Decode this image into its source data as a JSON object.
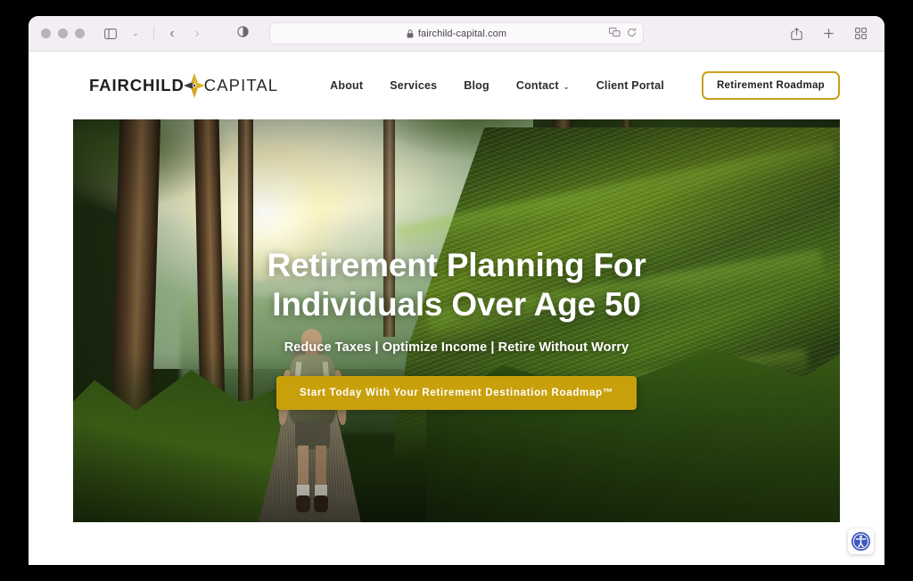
{
  "browser": {
    "window_controls": [
      "close",
      "minimize",
      "maximize"
    ],
    "sidebar_icon": "sidebar-icon",
    "sidebar_caret": "⌄",
    "back_glyph": "‹",
    "forward_glyph": "›",
    "privacy_icon": "privacy-shield-icon",
    "url": "fairchild-capital.com",
    "url_lock": "lock-icon",
    "extension_icon": "extensions-icon",
    "reload_glyph": "↻",
    "share_icon": "share-icon",
    "new_tab_glyph": "+",
    "tab_overview_icon": "tab-overview-icon"
  },
  "site": {
    "logo": {
      "word1": "FAIRCHILD",
      "word2": "CAPITAL",
      "mark": "compass-star-emblem",
      "gold": "#d8a81c"
    },
    "nav": {
      "items": [
        {
          "label": "About",
          "has_caret": false
        },
        {
          "label": "Services",
          "has_caret": false
        },
        {
          "label": "Blog",
          "has_caret": false
        },
        {
          "label": "Contact",
          "has_caret": true
        },
        {
          "label": "Client Portal",
          "has_caret": false
        }
      ],
      "caret_glyph": "⌄",
      "cta_label": "Retirement Roadmap"
    },
    "hero": {
      "title_line1": "Retirement Planning For",
      "title_line2": "Individuals Over Age 50",
      "subtitle": "Reduce Taxes | Optimize Income | Retire Without Worry",
      "button_label": "Start Today With Your Retirement Destination Roadmap™",
      "image_alt": "hiker-on-forest-trail-at-sunrise",
      "button_color": "#c8a00c"
    },
    "accessibility_widget": {
      "icon": "accessibility-icon",
      "color": "#4058bf"
    }
  }
}
